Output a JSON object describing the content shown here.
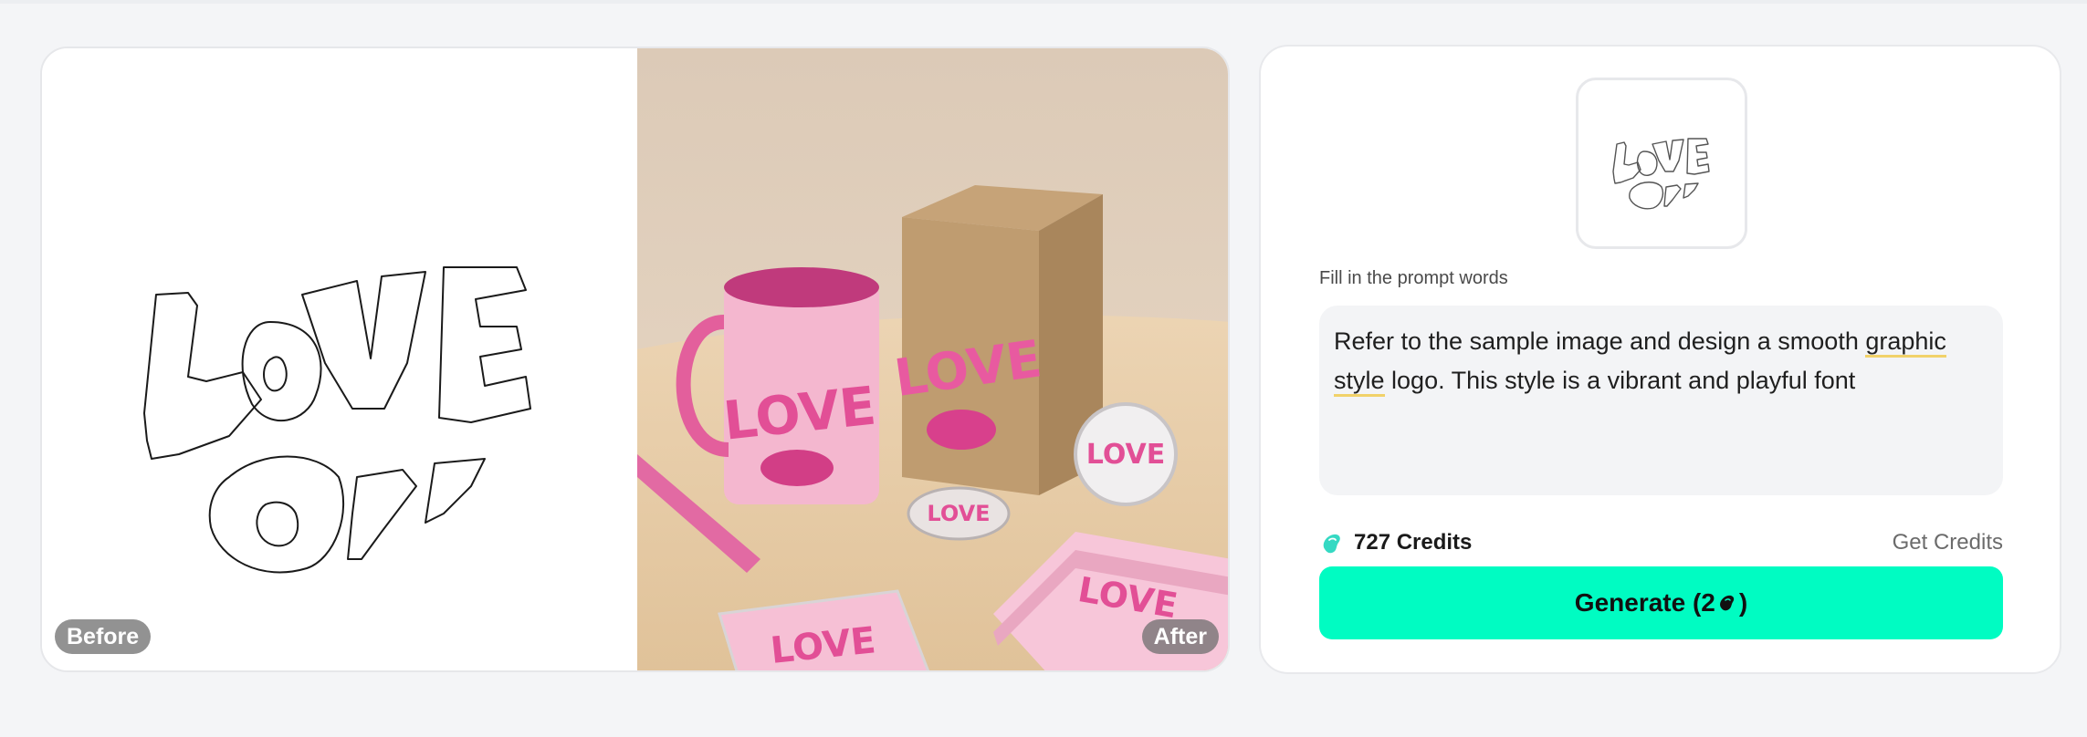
{
  "comparison": {
    "before_label": "Before",
    "after_label": "After",
    "sketch_text": "LOVE"
  },
  "prompt": {
    "label": "Fill in the prompt words",
    "text_before": "Refer to the sample image and design a smooth ",
    "underlined_1": "graphic",
    "text_middle": " ",
    "underlined_2": "style",
    "text_after": " logo. This style is a vibrant and playful font"
  },
  "credits": {
    "count_label": "727 Credits",
    "get_credits_label": "Get Credits"
  },
  "generate": {
    "label_prefix": "Generate (2",
    "label_suffix": ")"
  },
  "colors": {
    "accent": "#00fcc2",
    "pink": "#e85aa0",
    "coin": "#35d9c3"
  }
}
